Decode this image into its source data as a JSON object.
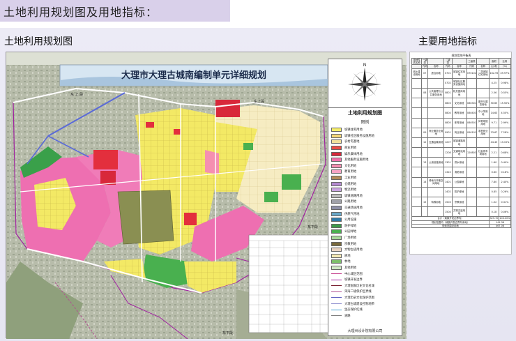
{
  "header": {
    "title": "土地利用规划图及用地指标："
  },
  "sections": {
    "left_heading": "土地利用规划图",
    "right_heading": "主要用地指标"
  },
  "map": {
    "banner_title": "大理市大理古城南编制单元详细规划",
    "road_labels": [
      "东 上 段",
      "东上段",
      "东下段",
      "东下段"
    ],
    "legend_caption": "土地利用规划图",
    "legend_subcaption": "图例",
    "company": "大理州设计院有限公司",
    "legend": [
      {
        "label": "城镇住宅用地",
        "color": "#f4ec6a",
        "kind": "fill"
      },
      {
        "label": "城镇社区服务设施用地",
        "color": "#f6d77a",
        "kind": "fill"
      },
      {
        "label": "农村宅基地",
        "color": "#f0df9a",
        "kind": "fill"
      },
      {
        "label": "商业用地",
        "color": "#e84a45",
        "kind": "fill"
      },
      {
        "label": "娱乐康体用地",
        "color": "#d8283a",
        "kind": "fill"
      },
      {
        "label": "其他服务设施用地",
        "color": "#f06fa8",
        "kind": "fill"
      },
      {
        "label": "文化用地",
        "color": "#f58fb0",
        "kind": "fill"
      },
      {
        "label": "教育用地",
        "color": "#f7a3c4",
        "kind": "fill"
      },
      {
        "label": "工业用地",
        "color": "#b38c5a",
        "kind": "fill"
      },
      {
        "label": "仓储用地",
        "color": "#b48ad0",
        "kind": "fill"
      },
      {
        "label": "物流用地",
        "color": "#c9a3e0",
        "kind": "fill"
      },
      {
        "label": "城镇道路用地",
        "color": "#bdbdbd",
        "kind": "fill"
      },
      {
        "label": "公路用地",
        "color": "#9fa0a8",
        "kind": "fill"
      },
      {
        "label": "交通场站用地",
        "color": "#8d8fa6",
        "kind": "fill"
      },
      {
        "label": "供燃气用地",
        "color": "#6aa8c8",
        "kind": "fill"
      },
      {
        "label": "公用设施",
        "color": "#2f7aa8",
        "kind": "fill"
      },
      {
        "label": "防护绿地",
        "color": "#3c9a4a",
        "kind": "fill"
      },
      {
        "label": "公园绿地",
        "color": "#49b04f",
        "kind": "fill"
      },
      {
        "label": "广场用地",
        "color": "#a8d89c",
        "kind": "fill"
      },
      {
        "label": "宗教用地",
        "color": "#7a6b3c",
        "kind": "fill"
      },
      {
        "label": "文物古迹用地",
        "color": "#e9d2c0",
        "kind": "fill"
      },
      {
        "label": "耕地",
        "color": "#f6e9b5",
        "kind": "fill"
      },
      {
        "label": "林地",
        "color": "#7cbf6a",
        "kind": "fill"
      },
      {
        "label": "其他用地",
        "color": "#d0e8c6",
        "kind": "fill"
      },
      {
        "label": "中心城区范围",
        "color": "#c43b8a",
        "kind": "line"
      },
      {
        "label": "城镇开发边界",
        "color": "#a020a0",
        "kind": "line"
      },
      {
        "label": "大理国家历史文化名城",
        "color": "#7a2030",
        "kind": "line"
      },
      {
        "label": "洱海二级保护区界线",
        "color": "#b05090",
        "kind": "line"
      },
      {
        "label": "大理历史文化保护范围",
        "color": "#6060c0",
        "kind": "line"
      },
      {
        "label": "大理古城建设控制地带",
        "color": "#9090d0",
        "kind": "line"
      },
      {
        "label": "生态保护红线",
        "color": "#40a0d0",
        "kind": "line"
      },
      {
        "label": "道路",
        "color": "#808080",
        "kind": "line"
      }
    ]
  },
  "table": {
    "caption": "规划用地平衡表",
    "header_row1": [
      "用地性质名称",
      "一级类",
      "",
      "二级类",
      "",
      "三级类",
      "",
      "面积",
      "比例"
    ],
    "header_row2": [
      "",
      "代码",
      "名称",
      "代码",
      "名称",
      "代码",
      "名称",
      "(公顷)",
      "(%)"
    ],
    "rows": [
      [
        "城乡建设用地",
        "07",
        "居住用地",
        "0701",
        "城镇住宅用地",
        "070102",
        "二类城镇住宅用地",
        "162.95",
        "49.97%"
      ],
      [
        "",
        "",
        "",
        "0702",
        "城镇社区服务设施用地",
        "",
        "",
        "4.25",
        "0.98%"
      ],
      [
        "",
        "08",
        "公共管理与公共服务用地",
        "0801",
        "机关团体用地",
        "",
        "",
        "2.56",
        "0.55%"
      ],
      [
        "",
        "",
        "",
        "0803",
        "文化用地",
        "080301",
        "图书与展览用地",
        "50.65",
        "15.50%"
      ],
      [
        "",
        "",
        "",
        "0804",
        "教育用地",
        "080403",
        "中小学用地",
        "14.63",
        "4.50%"
      ],
      [
        "",
        "",
        "",
        "0805",
        "体育用地",
        "080501",
        "体育场馆用地",
        "9.71",
        "2.99%"
      ],
      [
        "",
        "09",
        "商业服务业用地",
        "0901",
        "商业用地",
        "090101",
        "零售商业用地",
        "23.67",
        "7.28%"
      ],
      [
        "",
        "12",
        "交通运输用地",
        "1207",
        "城镇道路用地",
        "",
        "",
        "44.45",
        "13.15%"
      ],
      [
        "",
        "",
        "",
        "1208",
        "交通场站用地",
        "120803",
        "社会停车场用地",
        "2.21",
        "0.68%"
      ],
      [
        "",
        "13",
        "公用设施用地",
        "1301",
        "供水用地",
        "",
        "",
        "1.60",
        "0.49%"
      ],
      [
        "",
        "",
        "",
        "1310",
        "消防用地",
        "",
        "",
        "0.60",
        "0.18%"
      ],
      [
        "",
        "14",
        "绿地与开敞空间用地",
        "1401",
        "公园绿地",
        "",
        "",
        "7.80",
        "2.40%"
      ],
      [
        "",
        "",
        "",
        "1402",
        "防护绿地",
        "",
        "",
        "0.85",
        "0.26%"
      ],
      [
        "",
        "15",
        "特殊用地",
        "1503",
        "宗教用地",
        "",
        "",
        "1.02",
        "0.31%"
      ],
      [
        "",
        "",
        "",
        "1504",
        "文物古迹用地",
        "",
        "",
        "0.18",
        "0.06%"
      ]
    ],
    "total_label": "合计（城镇开发边界内）",
    "total_area": "325.70",
    "total_pct": "100.00%",
    "footer_rows": [
      [
        "规划范围内（城镇开发边界外用地）",
        "141.38"
      ],
      [
        "规划范围总用地",
        "467.08"
      ]
    ]
  }
}
